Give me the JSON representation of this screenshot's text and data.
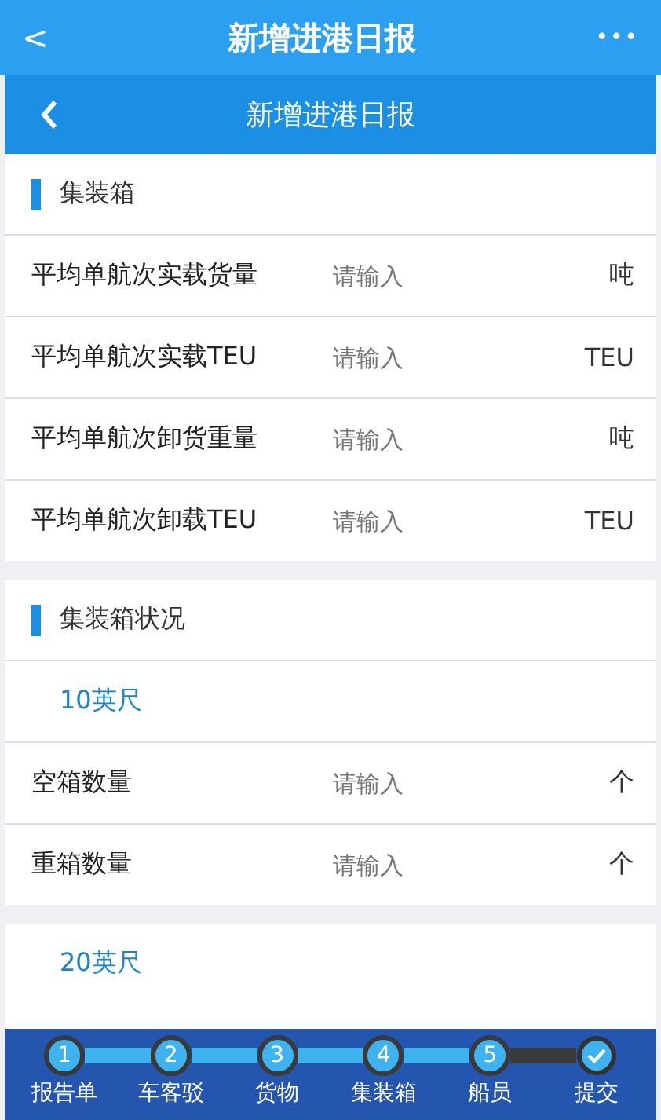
{
  "app_bar": {
    "back": "<",
    "title": "新增进港日报",
    "more": "•••"
  },
  "header": {
    "title": "新增进港日报"
  },
  "sections": [
    {
      "title": "集装箱",
      "items": [
        {
          "kind": "field",
          "label": "平均单航次实载货量",
          "placeholder": "请输入",
          "unit": "吨"
        },
        {
          "kind": "field",
          "label": "平均单航次实载TEU",
          "placeholder": "请输入",
          "unit": "TEU"
        },
        {
          "kind": "field",
          "label": "平均单航次卸货重量",
          "placeholder": "请输入",
          "unit": "吨"
        },
        {
          "kind": "field",
          "label": "平均单航次卸载TEU",
          "placeholder": "请输入",
          "unit": "TEU"
        }
      ]
    },
    {
      "title": "集装箱状况",
      "items": [
        {
          "kind": "subheader",
          "label": "10英尺"
        },
        {
          "kind": "field",
          "label": "空箱数量",
          "placeholder": "请输入",
          "unit": "个"
        },
        {
          "kind": "field",
          "label": "重箱数量",
          "placeholder": "请输入",
          "unit": "个"
        }
      ]
    },
    {
      "items": [
        {
          "kind": "subheader",
          "label": "20英尺"
        }
      ]
    }
  ],
  "steps": [
    {
      "kind": "number",
      "badge": "1",
      "label": "报告单",
      "done": true
    },
    {
      "kind": "number",
      "badge": "2",
      "label": "车客驳",
      "done": true
    },
    {
      "kind": "number",
      "badge": "3",
      "label": "货物",
      "done": true
    },
    {
      "kind": "number",
      "badge": "4",
      "label": "集装箱",
      "done": true
    },
    {
      "kind": "number",
      "badge": "5",
      "label": "船员",
      "done": false
    },
    {
      "kind": "check",
      "label": "提交"
    }
  ]
}
